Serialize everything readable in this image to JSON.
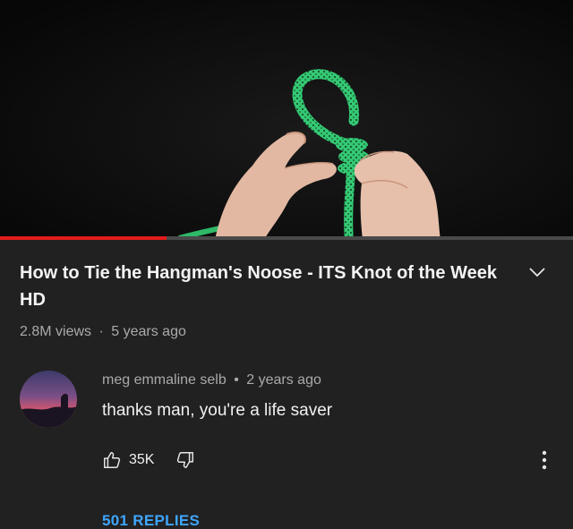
{
  "video": {
    "progress_fraction": 0.29,
    "progress_color": "#e31b1b",
    "rope_color": "#34c873"
  },
  "title": "How to Tie the Hangman's Noose - ITS Knot of the Week HD",
  "meta": {
    "views": "2.8M views",
    "separator": "·",
    "age": "5 years ago"
  },
  "comment": {
    "author": "meg emmaline selb",
    "separator": "•",
    "age": "2 years ago",
    "text": "thanks man, you're a life saver",
    "likes": "35K"
  },
  "replies_label": "501 REPLIES",
  "icons": {
    "expand": "chevron-down-icon",
    "like": "thumbs-up-icon",
    "dislike": "thumbs-down-icon",
    "more": "more-vertical-icon"
  },
  "colors": {
    "background": "#212121",
    "link": "#3ea6ff",
    "secondary_text": "#aaaaaa"
  }
}
